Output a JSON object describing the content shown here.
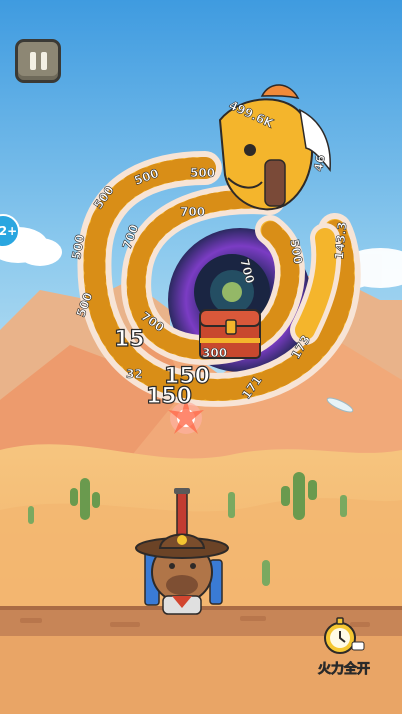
{
  "hud": {
    "side_badge": "2+",
    "power_button_label": "火力全开"
  },
  "damage_popups": [
    {
      "text": "15",
      "size": 22
    },
    {
      "text": "150",
      "size": 22
    },
    {
      "text": "150",
      "size": 22
    }
  ],
  "coil_labels": [
    "499.6K",
    "500",
    "500",
    "500",
    "500",
    "500",
    "700",
    "700",
    "700",
    "700",
    "500",
    "143.3",
    "46",
    "173",
    "171",
    "300",
    "32"
  ],
  "colors": {
    "sky_top": "#3f9be0",
    "sky_bottom": "#bfe3f4",
    "sand": "#f2b36b",
    "scale": "#f4b52c",
    "ground": "#c78557"
  }
}
